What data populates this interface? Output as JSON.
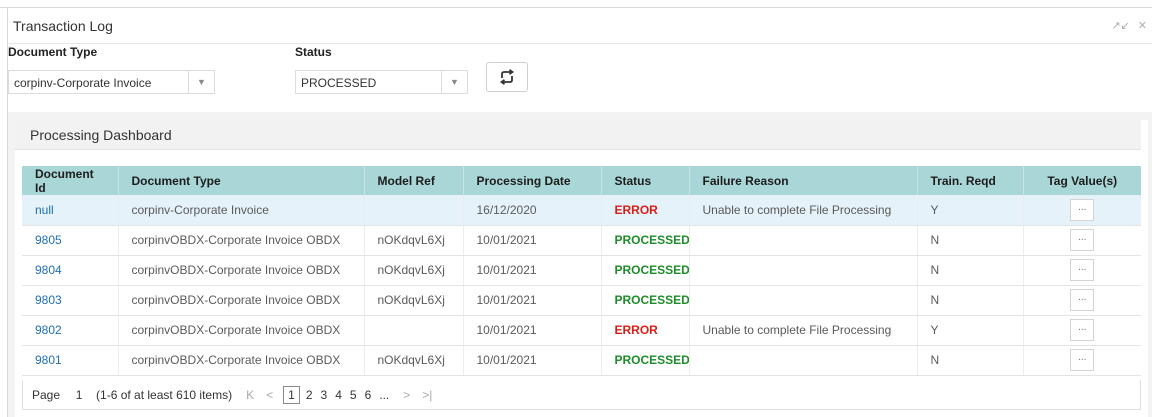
{
  "window": {
    "title": "Transaction Log",
    "collapse_icon": "collapse-arrows-icon",
    "close_icon": "close-icon",
    "collapse_glyph": "↗↙",
    "close_glyph": "✕"
  },
  "filters": {
    "document_type_label": "Document Type",
    "document_type_value": "corpinv-Corporate Invoice",
    "status_label": "Status",
    "status_value": "PROCESSED",
    "refresh_icon": "refresh-icon"
  },
  "dashboard": {
    "title": "Processing Dashboard",
    "columns": [
      "Document Id",
      "Document Type",
      "Model Ref",
      "Processing Date",
      "Status",
      "Failure Reason",
      "Train. Reqd",
      "Tag Value(s)"
    ],
    "rows": [
      {
        "id": "null",
        "doc_type": "corpinv-Corporate Invoice",
        "model_ref": "",
        "date": "16/12/2020",
        "status": "ERROR",
        "reason": "Unable to complete File Processing",
        "train": "Y",
        "tag": "..."
      },
      {
        "id": "9805",
        "doc_type": "corpinvOBDX-Corporate Invoice OBDX",
        "model_ref": "nOKdqvL6Xj",
        "date": "10/01/2021",
        "status": "PROCESSED",
        "reason": "",
        "train": "N",
        "tag": "..."
      },
      {
        "id": "9804",
        "doc_type": "corpinvOBDX-Corporate Invoice OBDX",
        "model_ref": "nOKdqvL6Xj",
        "date": "10/01/2021",
        "status": "PROCESSED",
        "reason": "",
        "train": "N",
        "tag": "..."
      },
      {
        "id": "9803",
        "doc_type": "corpinvOBDX-Corporate Invoice OBDX",
        "model_ref": "nOKdqvL6Xj",
        "date": "10/01/2021",
        "status": "PROCESSED",
        "reason": "",
        "train": "N",
        "tag": "..."
      },
      {
        "id": "9802",
        "doc_type": "corpinvOBDX-Corporate Invoice OBDX",
        "model_ref": "",
        "date": "10/01/2021",
        "status": "ERROR",
        "reason": "Unable to complete File Processing",
        "train": "Y",
        "tag": "..."
      },
      {
        "id": "9801",
        "doc_type": "corpinvOBDX-Corporate Invoice OBDX",
        "model_ref": "nOKdqvL6Xj",
        "date": "10/01/2021",
        "status": "PROCESSED",
        "reason": "",
        "train": "N",
        "tag": "..."
      }
    ],
    "selected_row": 0
  },
  "pager": {
    "page_label": "Page",
    "page_value": "1",
    "info": "(1-6 of at least 610 items)",
    "first_glyph": "K",
    "prev_glyph": "<",
    "pages": [
      "1",
      "2",
      "3",
      "4",
      "5",
      "6",
      "..."
    ],
    "next_glyph": ">",
    "last_glyph": ">|"
  },
  "colors": {
    "header_bg": "#a9d7d8",
    "selected_row_bg": "#e5f2f9",
    "link": "#1f6fb2",
    "error": "#d91e18",
    "processed": "#1e8c2a"
  }
}
